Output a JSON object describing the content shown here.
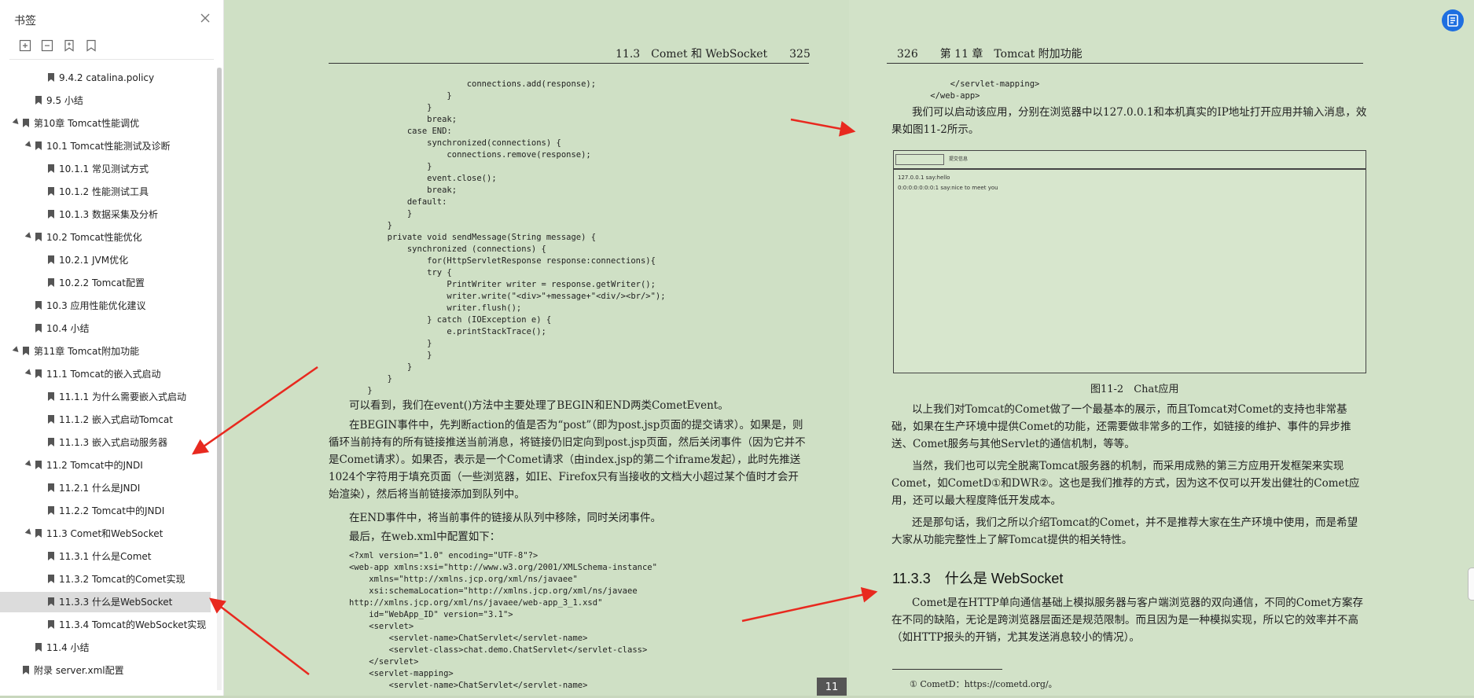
{
  "sidebar": {
    "title": "书签",
    "outline": [
      {
        "label": "9.4.2 catalina.policy",
        "level": 3,
        "expander": false
      },
      {
        "label": "9.5 小结",
        "level": 2,
        "expander": false
      },
      {
        "label": "第10章 Tomcat性能调优",
        "level": 1,
        "expander": true
      },
      {
        "label": "10.1 Tomcat性能测试及诊断",
        "level": 2,
        "expander": true
      },
      {
        "label": "10.1.1 常见测试方式",
        "level": 3,
        "expander": false
      },
      {
        "label": "10.1.2 性能测试工具",
        "level": 3,
        "expander": false
      },
      {
        "label": "10.1.3 数据采集及分析",
        "level": 3,
        "expander": false
      },
      {
        "label": "10.2 Tomcat性能优化",
        "level": 2,
        "expander": true
      },
      {
        "label": "10.2.1 JVM优化",
        "level": 3,
        "expander": false
      },
      {
        "label": "10.2.2 Tomcat配置",
        "level": 3,
        "expander": false
      },
      {
        "label": "10.3 应用性能优化建议",
        "level": 2,
        "expander": false
      },
      {
        "label": "10.4 小结",
        "level": 2,
        "expander": false
      },
      {
        "label": "第11章 Tomcat附加功能",
        "level": 1,
        "expander": true
      },
      {
        "label": "11.1 Tomcat的嵌入式启动",
        "level": 2,
        "expander": true
      },
      {
        "label": "11.1.1 为什么需要嵌入式启动",
        "level": 3,
        "expander": false
      },
      {
        "label": "11.1.2 嵌入式启动Tomcat",
        "level": 3,
        "expander": false
      },
      {
        "label": "11.1.3 嵌入式启动服务器",
        "level": 3,
        "expander": false
      },
      {
        "label": "11.2 Tomcat中的JNDI",
        "level": 2,
        "expander": true
      },
      {
        "label": "11.2.1 什么是JNDI",
        "level": 3,
        "expander": false
      },
      {
        "label": "11.2.2 Tomcat中的JNDI",
        "level": 3,
        "expander": false
      },
      {
        "label": "11.3 Comet和WebSocket",
        "level": 2,
        "expander": true
      },
      {
        "label": "11.3.1 什么是Comet",
        "level": 3,
        "expander": false
      },
      {
        "label": "11.3.2 Tomcat的Comet实现",
        "level": 3,
        "expander": false
      },
      {
        "label": "11.3.3 什么是WebSocket",
        "level": 3,
        "expander": false,
        "active": true
      },
      {
        "label": "11.3.4 Tomcat的WebSocket实现",
        "level": 3,
        "expander": false
      },
      {
        "label": "11.4 小结",
        "level": 2,
        "expander": false
      },
      {
        "label": "附录 server.xml配置",
        "level": 1,
        "expander": false
      }
    ]
  },
  "left_page": {
    "header": "11.3　Comet 和 WebSocket　　325",
    "code1": "                        connections.add(response);\n                    }\n                }\n                break;\n            case END:\n                synchronized(connections) {\n                    connections.remove(response);\n                }\n                event.close();\n                break;\n            default:\n            }\n        }\n        private void sendMessage(String message) {\n            synchronized (connections) {\n                for(HttpServletResponse response:connections){\n                try {\n                    PrintWriter writer = response.getWriter();\n                    writer.write(\"<div>\"+message+\"<div/><br/>\");\n                    writer.flush();\n                } catch (IOException e) {\n                    e.printStackTrace();\n                }\n                }\n            }\n        }\n    }",
    "p1": "可以看到，我们在event()方法中主要处理了BEGIN和END两类CometEvent。",
    "p2": "在BEGIN事件中，先判断action的值是否为“post”（即为post.jsp页面的提交请求）。如果是，则循环当前持有的所有链接推送当前消息，将链接仍旧定向到post.jsp页面，然后关闭事件（因为它并不是Comet请求）。如果否，表示是一个Comet请求（由index.jsp的第二个iframe发起），此时先推送1024个字符用于填充页面（一些浏览器，如IE、Firefox只有当接收的文档大小超过某个值时才会开始渲染），然后将当前链接添加到队列中。",
    "p3": "在END事件中，将当前事件的链接从队列中移除，同时关闭事件。",
    "p4": "最后，在web.xml中配置如下：",
    "code2": "<?xml version=\"1.0\" encoding=\"UTF-8\"?>\n<web-app xmlns:xsi=\"http://www.w3.org/2001/XMLSchema-instance\"\n    xmlns=\"http://xmlns.jcp.org/xml/ns/javaee\"\n    xsi:schemaLocation=\"http://xmlns.jcp.org/xml/ns/javaee\nhttp://xmlns.jcp.org/xml/ns/javaee/web-app_3_1.xsd\"\n    id=\"WebApp_ID\" version=\"3.1\">\n    <servlet>\n        <servlet-name>ChatServlet</servlet-name>\n        <servlet-class>chat.demo.ChatServlet</servlet-class>\n    </servlet>\n    <servlet-mapping>\n        <servlet-name>ChatServlet</servlet-name>"
  },
  "right_page": {
    "header": "326　　第 11 章　Tomcat 附加功能",
    "code1": "        </servlet-mapping>\n    </web-app>",
    "p1": "我们可以启动该应用，分别在浏览器中以127.0.0.1和本机真实的IP地址打开应用并输入消息，效果如图11-2所示。",
    "figure": {
      "send": "提交信息",
      "line1": "127.0.0.1 say:hello",
      "line2": "0:0:0:0:0:0:0:1 say:nice to meet you",
      "caption": "图11-2　Chat应用"
    },
    "p2": "以上我们对Tomcat的Comet做了一个最基本的展示，而且Tomcat对Comet的支持也非常基础，如果在生产环境中提供Comet的功能，还需要做非常多的工作，如链接的维护、事件的异步推送、Comet服务与其他Servlet的通信机制，等等。",
    "p3": "当然，我们也可以完全脱离Tomcat服务器的机制，而采用成熟的第三方应用开发框架来实现Comet，如CometD①和DWR②。这也是我们推荐的方式，因为这不仅可以开发出健壮的Comet应用，还可以最大程度降低开发成本。",
    "p4": "还是那句话，我们之所以介绍Tomcat的Comet，并不是推荐大家在生产环境中使用，而是希望大家从功能完整性上了解Tomcat提供的相关特性。",
    "section": "11.3.3　什么是 WebSocket",
    "p5": "Comet是在HTTP单向通信基础上模拟服务器与客户端浏览器的双向通信，不同的Comet方案存在不同的缺陷，无论是跨浏览器层面还是规范限制。而且因为是一种模拟实现，所以它的效率并不高（如HTTP报头的开销，尤其发送消息较小的情况）。",
    "footnote": "① CometD：https://cometd.org/。",
    "page_badge": "11"
  },
  "colors": {
    "arrow": "#e8291f",
    "accent": "#1f6fe0",
    "page": "#cfe0c5"
  }
}
